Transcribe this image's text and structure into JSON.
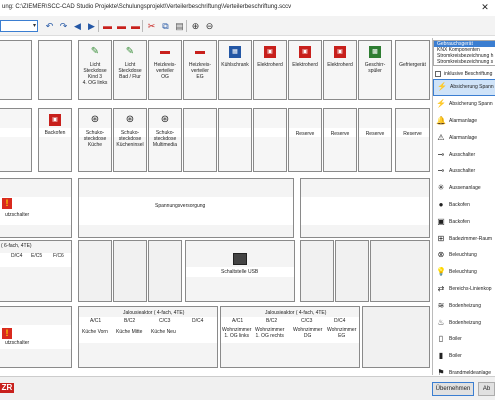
{
  "titlebar": {
    "title": "ung: C:\\ZIEMER\\SCC-CAD Studio Projekte\\Schulungsprojekt\\Verteilerbeschriftung\\Verteilerbeschriftung.sccv",
    "close_glyph": "✕"
  },
  "toolbar": {
    "combo_value": "",
    "combo_arrow": "▾",
    "icons": [
      {
        "name": "undo-icon",
        "glyph": "↶",
        "color": "#2457a5"
      },
      {
        "name": "redo-icon",
        "glyph": "↷",
        "color": "#2457a5"
      },
      {
        "name": "move-left-icon",
        "glyph": "◀",
        "color": "#2457a5"
      },
      {
        "name": "move-right-icon",
        "glyph": "▶",
        "color": "#2457a5"
      },
      {
        "name": "delete-row-icon",
        "glyph": "▬",
        "color": "#c8201c"
      },
      {
        "name": "delete-column-icon",
        "glyph": "▬",
        "color": "#c8201c"
      },
      {
        "name": "delete-cell-icon",
        "glyph": "▬",
        "color": "#c8201c"
      },
      {
        "name": "cut-icon",
        "glyph": "✂",
        "color": "#c8201c"
      },
      {
        "name": "copy-icon",
        "glyph": "⧉",
        "color": "#2457a5"
      },
      {
        "name": "paste-icon",
        "glyph": "▤",
        "color": "#555555"
      },
      {
        "name": "zoom-in-icon",
        "glyph": "⊕",
        "color": "#333333"
      },
      {
        "name": "zoom-out-icon",
        "glyph": "⊖",
        "color": "#333333"
      }
    ]
  },
  "rows": {
    "row1": [
      {
        "label": "",
        "icon": ""
      },
      {
        "label": "",
        "icon": ""
      },
      {
        "label": "Licht\nSteckdose\nKind 3\n4. OG links",
        "icon": "✎"
      },
      {
        "label": "Licht\nSteckdose\nBad / Flur",
        "icon": "✎"
      },
      {
        "label": "Heizkreis-\nverteiler\nOG",
        "icon": "▬"
      },
      {
        "label": "Heizkreis-\nverteiler\nEG",
        "icon": "▬"
      },
      {
        "label": "Kühlschrank",
        "icon": "▦"
      },
      {
        "label": "Elektroherd",
        "icon": "▣"
      },
      {
        "label": "Elektroherd",
        "icon": "▣"
      },
      {
        "label": "Elektroherd",
        "icon": "▣"
      },
      {
        "label": "Geschirr-\nspüler",
        "icon": "▩"
      },
      {
        "label": "Gefriergerät",
        "icon": ""
      }
    ],
    "row2": [
      {
        "label": "",
        "icon": ""
      },
      {
        "label": "Backofen",
        "icon": "▣"
      },
      {
        "label": "Schuko-\nsteckdose\nKüche",
        "icon": "⊛"
      },
      {
        "label": "Schuko-\nsteckdose\nKücheninsel",
        "icon": "⊛"
      },
      {
        "label": "Schuko-\nsteckdose\nMultimedia",
        "icon": "⊛"
      },
      {
        "label": "",
        "icon": ""
      },
      {
        "label": "",
        "icon": ""
      },
      {
        "label": "",
        "icon": ""
      },
      {
        "label": "Reserve",
        "icon": ""
      },
      {
        "label": "Reserve",
        "icon": ""
      },
      {
        "label": "Reserve",
        "icon": ""
      },
      {
        "label": "Reserve",
        "icon": ""
      }
    ],
    "row3": {
      "left_label": "utzschalter",
      "right_label": "Spannungsversorgung"
    },
    "row4": {
      "group_label": "( 6-fach, 4TE)",
      "circuits": [
        "D/C4",
        "E/C5",
        "F/C6"
      ],
      "usb_label": "Schaltstelle USB"
    },
    "row5": {
      "left_label": "utzschalter",
      "jalousie1": {
        "header": "Jalousieaktor ( 4-fach, 4TE)",
        "circuits": [
          "A/C1",
          "B/C2",
          "C/C3",
          "D/C4"
        ],
        "names": [
          "Küche Vorn",
          "Küche Mitte",
          "Küche Neu",
          ""
        ]
      },
      "jalousie2": {
        "header": "Jalousieaktor ( 4-fach, 4TE)",
        "circuits": [
          "A/C1",
          "B/C2",
          "C/C3",
          "D/C4"
        ],
        "names": [
          "Wohnzimmer\n1. OG links",
          "Wohnzimmer\n1. OG rechts",
          "Wohnzimmer\nDG",
          "Wohnzimmer\nEG"
        ]
      }
    }
  },
  "sidepanel": {
    "list": [
      "Gebrauchsgerät",
      "KNX Komponenten",
      "Stromkreisbezeichnung h",
      "Stromkreisbezeichnung s"
    ],
    "list_selected": 0,
    "checkbox_label": "inklusive Beschriftung",
    "items": [
      {
        "label": "Absicherung Spann",
        "icon": "⚡",
        "icon_name": "fuse-voltage-icon",
        "selected": true
      },
      {
        "label": "Absicherung Spann",
        "icon": "⚡",
        "icon_name": "fuse-icon",
        "selected": false
      },
      {
        "label": "Alarmanlage",
        "icon": "🔔",
        "icon_name": "alarm-icon",
        "selected": false
      },
      {
        "label": "Alarmanlage",
        "icon": "⚠",
        "icon_name": "alarm-system-icon",
        "selected": false
      },
      {
        "label": "Ausschalter",
        "icon": "⊸",
        "icon_name": "switch-off-icon",
        "selected": false
      },
      {
        "label": "Ausschalter",
        "icon": "⊸",
        "icon_name": "switch-icon",
        "selected": false
      },
      {
        "label": "Aussenanlage",
        "icon": "✳",
        "icon_name": "outdoor-icon",
        "selected": false
      },
      {
        "label": "Backofen",
        "icon": "●",
        "icon_name": "oven-icon",
        "selected": false
      },
      {
        "label": "Backofen",
        "icon": "▣",
        "icon_name": "oven-box-icon",
        "selected": false
      },
      {
        "label": "Badezimmer-Raum",
        "icon": "⊞",
        "icon_name": "bathroom-icon",
        "selected": false
      },
      {
        "label": "Beleuchtung",
        "icon": "⊗",
        "icon_name": "light-icon",
        "selected": false
      },
      {
        "label": "Beleuchtung",
        "icon": "💡",
        "icon_name": "lightbulb-icon",
        "selected": false
      },
      {
        "label": "Bereichs-Linienkop",
        "icon": "⇄",
        "icon_name": "line-coupler-icon",
        "selected": false
      },
      {
        "label": "Bodenheizung",
        "icon": "≋",
        "icon_name": "floor-heating-icon",
        "selected": false
      },
      {
        "label": "Bodenheizung",
        "icon": "♨",
        "icon_name": "floor-heating-2-icon",
        "selected": false
      },
      {
        "label": "Boiler",
        "icon": "▯",
        "icon_name": "boiler-icon",
        "selected": false
      },
      {
        "label": "Boiler",
        "icon": "▮",
        "icon_name": "boiler-2-icon",
        "selected": false
      },
      {
        "label": "Brandmeldeanlage",
        "icon": "⚑",
        "icon_name": "fire-alarm-icon",
        "selected": false
      }
    ]
  },
  "statusbar": {
    "logo": "ZR",
    "ok_label": "Übernehmen",
    "cancel_label": "Ab"
  },
  "colors": {
    "accent": "#3b7ed1",
    "warning": "#d92a1e",
    "brand": "#c8201c"
  }
}
